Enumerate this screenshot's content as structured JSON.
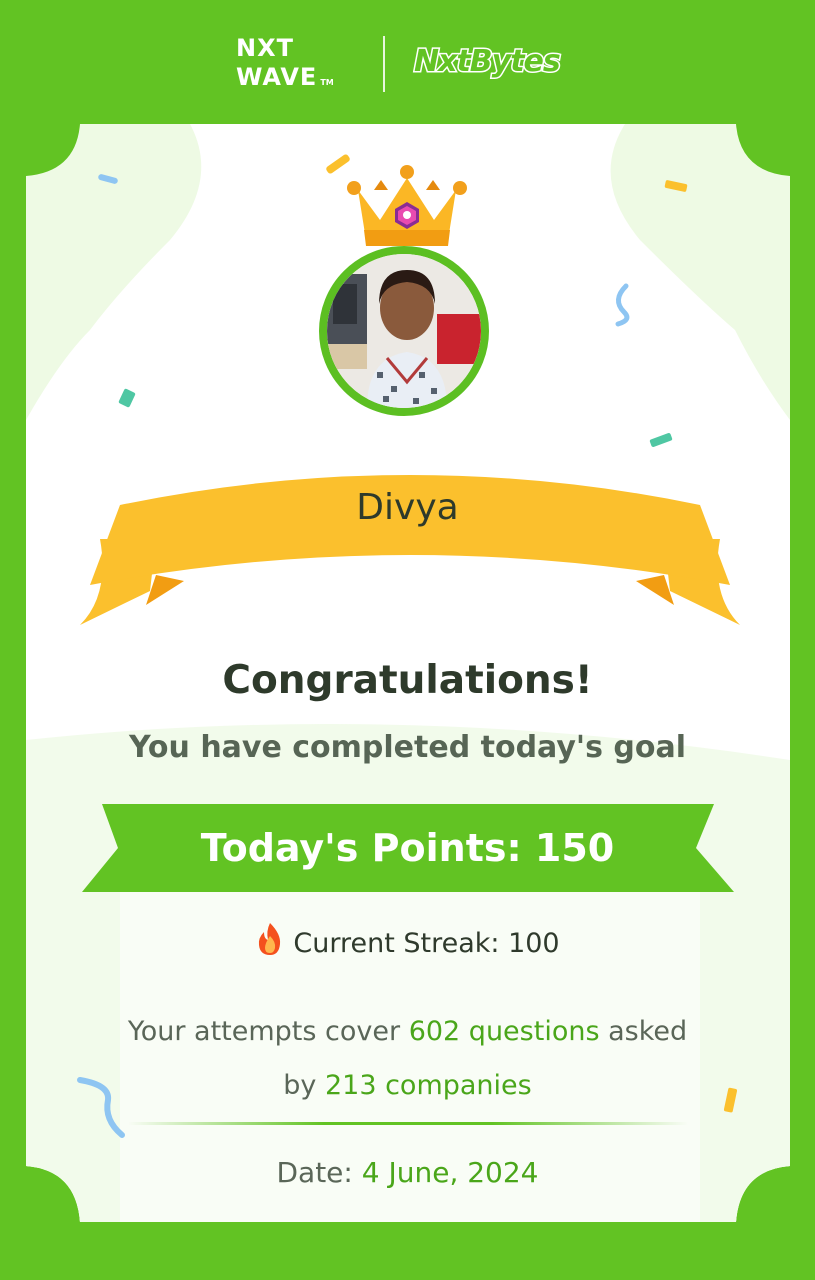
{
  "header": {
    "brand_line1": "NXT",
    "brand_line2": "WAVE",
    "brand_tm": "TM",
    "product": "NxtBytes"
  },
  "profile": {
    "name": "Divya"
  },
  "message": {
    "title": "Congratulations!",
    "subtitle": "You have completed today's goal"
  },
  "points": {
    "text": "Today's Points: 150"
  },
  "streak": {
    "icon": "fire-icon",
    "text": "Current Streak: 100"
  },
  "stats": {
    "prefix": "Your attempts cover",
    "questions": "602 questions",
    "middle": "asked",
    "by": "by",
    "companies": "213 companies"
  },
  "date": {
    "label": "Date:",
    "value": "4 June, 2024"
  },
  "colors": {
    "brand_green": "#62c323",
    "ribbon_yellow": "#fbc02d",
    "card_bg": "#eefae4",
    "text_dark": "#2e3a2b"
  }
}
